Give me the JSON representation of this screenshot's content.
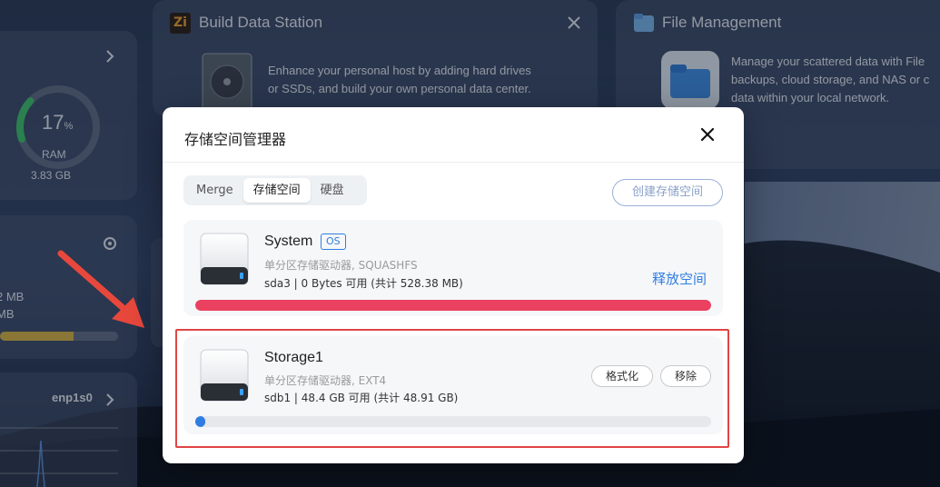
{
  "background": {
    "build_station": {
      "title": "Build Data Station",
      "logo": "Zi",
      "description_line1": "Enhance your personal host by adding hard drives",
      "description_line2": "or SSDs, and build your own personal data center."
    },
    "file_management": {
      "title": "File Management",
      "description_line1": "Manage your scattered data with File",
      "description_line2": "backups, cloud storage, and NAS or c",
      "description_line3": "data within your local network."
    },
    "ram_widget": {
      "percent": "17",
      "percent_sign": "%",
      "label": "RAM",
      "size": "3.83 GB",
      "usage_fraction": 0.17
    },
    "storage_widget": {
      "line1": "2 MB",
      "line2": "MB"
    },
    "network_widget": {
      "interface": "enp1s0"
    },
    "arrow_color": "#e8483c"
  },
  "modal": {
    "title": "存储空间管理器",
    "tabs": [
      {
        "label": "Merge",
        "active": false
      },
      {
        "label": "存储空间",
        "active": true
      },
      {
        "label": "硬盘",
        "active": false
      }
    ],
    "create_button": "创建存储空间",
    "volumes": [
      {
        "name": "System",
        "badge": "OS",
        "type": "单分区存储驱动器, SQUASHFS",
        "detail": "sda3 | 0 Bytes 可用 (共计 528.38 MB)",
        "action": "释放空间",
        "usage_fraction": 1.0,
        "bar_color": "#e9415f"
      },
      {
        "name": "Storage1",
        "type": "单分区存储驱动器, EXT4",
        "detail": "sdb1 | 48.4 GB 可用 (共计 48.91 GB)",
        "format_button": "格式化",
        "remove_button": "移除",
        "usage_fraction": 0.01,
        "bar_color": "#2f7de1"
      }
    ]
  }
}
